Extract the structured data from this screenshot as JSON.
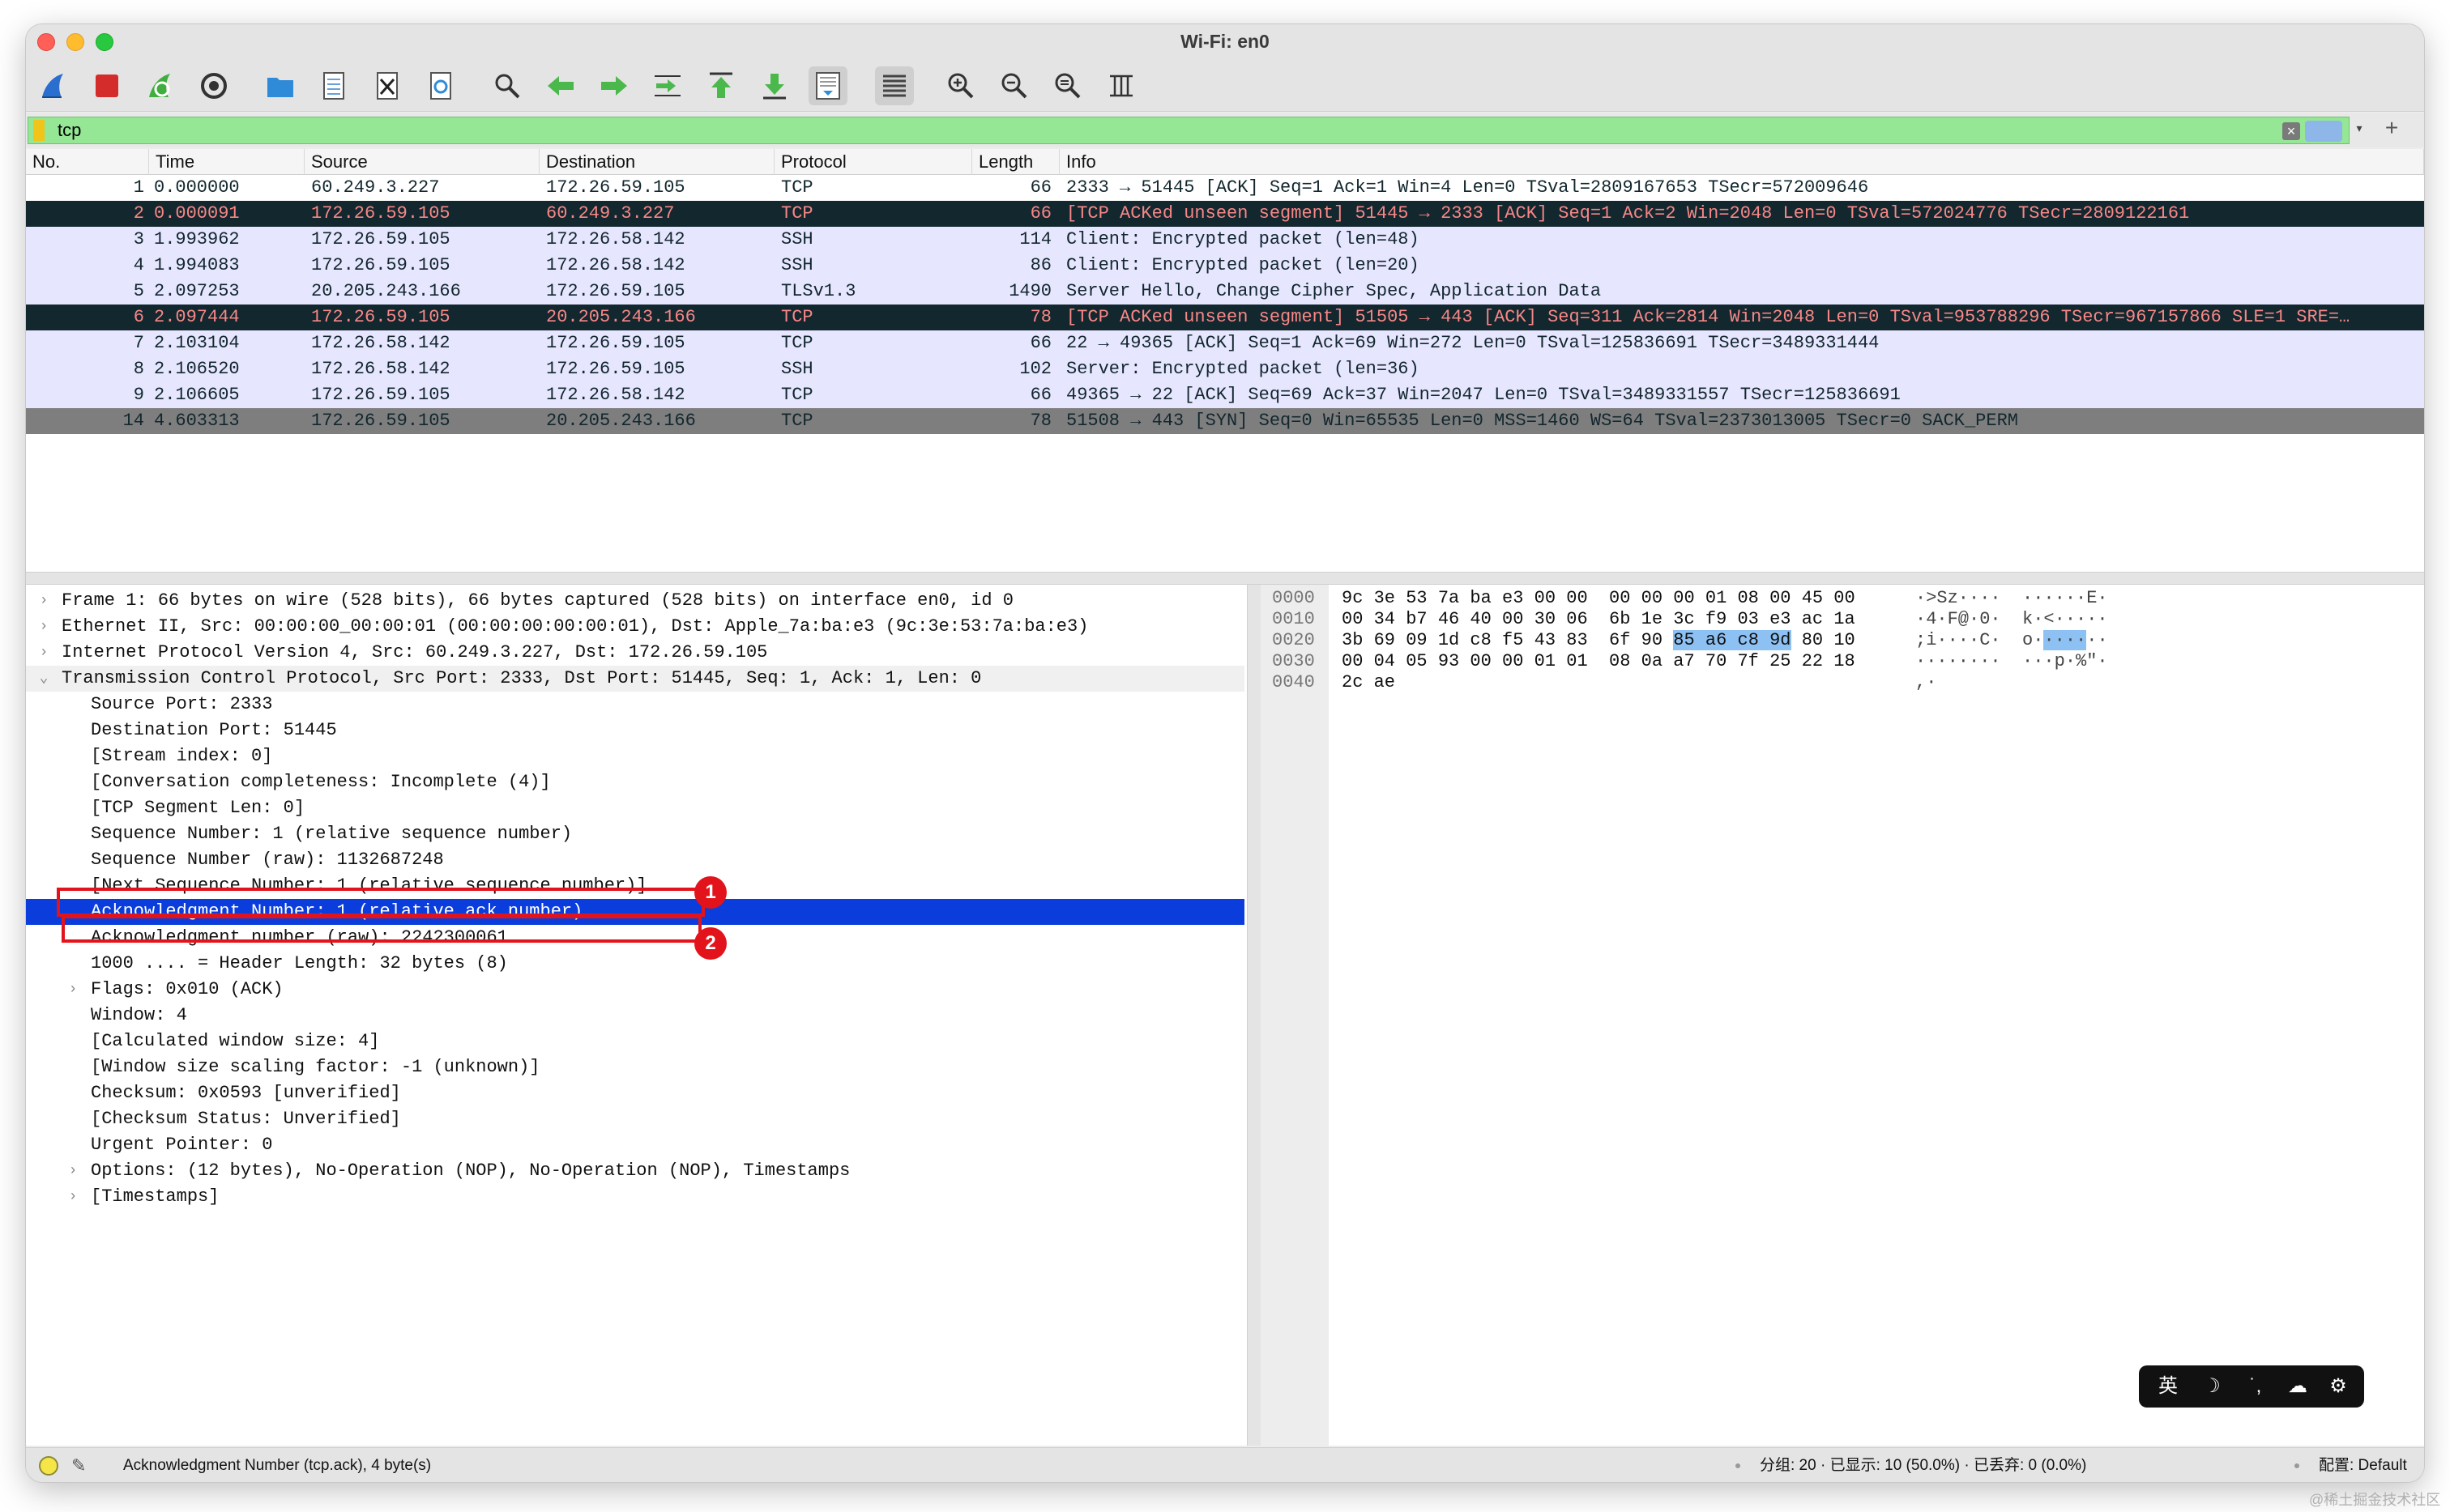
{
  "window": {
    "title": "Wi-Fi: en0"
  },
  "toolbar": {
    "icons": [
      "shark-fin-start-icon",
      "stop-capture-icon",
      "restart-capture-icon",
      "capture-options-icon",
      "open-file-icon",
      "save-file-icon",
      "close-file-icon",
      "reload-file-icon",
      "find-packet-icon",
      "go-back-icon",
      "go-forward-icon",
      "go-to-packet-icon",
      "first-packet-icon",
      "last-packet-icon",
      "autoscroll-icon",
      "colorize-icon",
      "zoom-in-icon",
      "zoom-out-icon",
      "normal-size-icon",
      "resize-columns-icon"
    ]
  },
  "filter": {
    "value": "tcp"
  },
  "packet_list": {
    "columns": [
      "No.",
      "Time",
      "Source",
      "Destination",
      "Protocol",
      "Length",
      "Info"
    ],
    "rows": [
      {
        "no": "1",
        "time": "0.000000",
        "src": "60.249.3.227",
        "dst": "172.26.59.105",
        "proto": "TCP",
        "len": "66",
        "info": "2333 → 51445 [ACK] Seq=1 Ack=1 Win=4 Len=0 TSval=2809167653 TSecr=572009646",
        "style": "r-white"
      },
      {
        "no": "2",
        "time": "0.000091",
        "src": "172.26.59.105",
        "dst": "60.249.3.227",
        "proto": "TCP",
        "len": "66",
        "info": "[TCP ACKed unseen segment] 51445 → 2333 [ACK] Seq=1 Ack=2 Win=2048 Len=0 TSval=572024776 TSecr=2809122161",
        "style": "r-err"
      },
      {
        "no": "3",
        "time": "1.993962",
        "src": "172.26.59.105",
        "dst": "172.26.58.142",
        "proto": "SSH",
        "len": "114",
        "info": "Client: Encrypted packet (len=48)",
        "style": "r-ack"
      },
      {
        "no": "4",
        "time": "1.994083",
        "src": "172.26.59.105",
        "dst": "172.26.58.142",
        "proto": "SSH",
        "len": "86",
        "info": "Client: Encrypted packet (len=20)",
        "style": "r-ack"
      },
      {
        "no": "5",
        "time": "2.097253",
        "src": "20.205.243.166",
        "dst": "172.26.59.105",
        "proto": "TLSv1.3",
        "len": "1490",
        "info": "Server Hello, Change Cipher Spec, Application Data",
        "style": "r-ack"
      },
      {
        "no": "6",
        "time": "2.097444",
        "src": "172.26.59.105",
        "dst": "20.205.243.166",
        "proto": "TCP",
        "len": "78",
        "info": "[TCP ACKed unseen segment] 51505 → 443 [ACK] Seq=311 Ack=2814 Win=2048 Len=0 TSval=953788296 TSecr=967157866 SLE=1 SRE=…",
        "style": "r-err"
      },
      {
        "no": "7",
        "time": "2.103104",
        "src": "172.26.58.142",
        "dst": "172.26.59.105",
        "proto": "TCP",
        "len": "66",
        "info": "22 → 49365 [ACK] Seq=1 Ack=69 Win=272 Len=0 TSval=125836691 TSecr=3489331444",
        "style": "r-ack"
      },
      {
        "no": "8",
        "time": "2.106520",
        "src": "172.26.58.142",
        "dst": "172.26.59.105",
        "proto": "SSH",
        "len": "102",
        "info": "Server: Encrypted packet (len=36)",
        "style": "r-ack"
      },
      {
        "no": "9",
        "time": "2.106605",
        "src": "172.26.59.105",
        "dst": "172.26.58.142",
        "proto": "TCP",
        "len": "66",
        "info": "49365 → 22 [ACK] Seq=69 Ack=37 Win=2047 Len=0 TSval=3489331557 TSecr=125836691",
        "style": "r-ack"
      },
      {
        "no": "14",
        "time": "4.603313",
        "src": "172.26.59.105",
        "dst": "20.205.243.166",
        "proto": "TCP",
        "len": "78",
        "info": "51508 → 443 [SYN] Seq=0 Win=65535 Len=0 MSS=1460 WS=64 TSval=2373013005 TSecr=0 SACK_PERM",
        "style": "r-sel"
      }
    ]
  },
  "details": {
    "rows": [
      {
        "text": "Frame 1: 66 bytes on wire (528 bits), 66 bytes captured (528 bits) on interface en0, id 0",
        "indent": 0,
        "arrow": "›",
        "cls": ""
      },
      {
        "text": "Ethernet II, Src: 00:00:00_00:00:01 (00:00:00:00:00:01), Dst: Apple_7a:ba:e3 (9c:3e:53:7a:ba:e3)",
        "indent": 0,
        "arrow": "›",
        "cls": ""
      },
      {
        "text": "Internet Protocol Version 4, Src: 60.249.3.227, Dst: 172.26.59.105",
        "indent": 0,
        "arrow": "›",
        "cls": ""
      },
      {
        "text": "Transmission Control Protocol, Src Port: 2333, Dst Port: 51445, Seq: 1, Ack: 1, Len: 0",
        "indent": 0,
        "arrow": "⌄",
        "cls": "hdr"
      },
      {
        "text": "Source Port: 2333",
        "indent": 1,
        "arrow": "",
        "cls": ""
      },
      {
        "text": "Destination Port: 51445",
        "indent": 1,
        "arrow": "",
        "cls": ""
      },
      {
        "text": "[Stream index: 0]",
        "indent": 1,
        "arrow": "",
        "cls": ""
      },
      {
        "text": "[Conversation completeness: Incomplete (4)]",
        "indent": 1,
        "arrow": "",
        "cls": ""
      },
      {
        "text": "[TCP Segment Len: 0]",
        "indent": 1,
        "arrow": "",
        "cls": ""
      },
      {
        "text": "Sequence Number: 1    (relative sequence number)",
        "indent": 1,
        "arrow": "",
        "cls": ""
      },
      {
        "text": "Sequence Number (raw): 1132687248",
        "indent": 1,
        "arrow": "",
        "cls": ""
      },
      {
        "text": "[Next Sequence Number: 1    (relative sequence number)]",
        "indent": 1,
        "arrow": "",
        "cls": ""
      },
      {
        "text": "Acknowledgment Number: 1    (relative ack number)",
        "indent": 1,
        "arrow": "",
        "cls": "sel"
      },
      {
        "text": "Acknowledgment number (raw): 2242300061",
        "indent": 1,
        "arrow": "",
        "cls": ""
      },
      {
        "text": "1000 .... = Header Length: 32 bytes (8)",
        "indent": 1,
        "arrow": "",
        "cls": ""
      },
      {
        "text": "Flags: 0x010 (ACK)",
        "indent": 1,
        "arrow": "›",
        "cls": ""
      },
      {
        "text": "Window: 4",
        "indent": 1,
        "arrow": "",
        "cls": ""
      },
      {
        "text": "[Calculated window size: 4]",
        "indent": 1,
        "arrow": "",
        "cls": ""
      },
      {
        "text": "[Window size scaling factor: -1 (unknown)]",
        "indent": 1,
        "arrow": "",
        "cls": ""
      },
      {
        "text": "Checksum: 0x0593 [unverified]",
        "indent": 1,
        "arrow": "",
        "cls": ""
      },
      {
        "text": "[Checksum Status: Unverified]",
        "indent": 1,
        "arrow": "",
        "cls": ""
      },
      {
        "text": "Urgent Pointer: 0",
        "indent": 1,
        "arrow": "",
        "cls": ""
      },
      {
        "text": "Options: (12 bytes), No-Operation (NOP), No-Operation (NOP), Timestamps",
        "indent": 1,
        "arrow": "›",
        "cls": ""
      },
      {
        "text": "[Timestamps]",
        "indent": 1,
        "arrow": "›",
        "cls": ""
      }
    ]
  },
  "annotations": {
    "badge1": "1",
    "badge2": "2"
  },
  "bytes": {
    "rows": [
      {
        "off": "0000",
        "hexA": "9c 3e 53 7a ba e3 00 00  00 00 00 01 08 00 45 00",
        "hexB": "",
        "hexC": "",
        "ascA": "·>Sz····  ······E·",
        "ascB": "",
        "ascC": ""
      },
      {
        "off": "0010",
        "hexA": "00 34 b7 46 40 00 30 06  6b 1e 3c f9 03 e3 ac 1a",
        "hexB": "",
        "hexC": "",
        "ascA": "·4·F@·0·  k·<·····",
        "ascB": "",
        "ascC": ""
      },
      {
        "off": "0020",
        "hexA": "3b 69 09 1d c8 f5 43 83  6f 90 ",
        "hexB": "85 a6 c8 9d",
        "hexC": " 80 10",
        "ascA": ";i····C·  o·",
        "ascB": "····",
        "ascC": "··"
      },
      {
        "off": "0030",
        "hexA": "00 04 05 93 00 00 01 01  08 0a a7 70 7f 25 22 18",
        "hexB": "",
        "hexC": "",
        "ascA": "········  ···p·%\"·",
        "ascB": "",
        "ascC": ""
      },
      {
        "off": "0040",
        "hexA": "2c ae",
        "hexB": "",
        "hexC": "",
        "ascA": ",·",
        "ascB": "",
        "ascC": ""
      }
    ]
  },
  "ime": {
    "lang": "英",
    "moon": "☽",
    "punct": "˙,",
    "cloud": "☁",
    "gear": "⚙"
  },
  "status": {
    "message": "Acknowledgment Number (tcp.ack), 4 byte(s)",
    "stats": "分组: 20 · 已显示: 10 (50.0%) · 已丢弃: 0 (0.0%)",
    "profile": "配置: Default"
  },
  "watermark": "@稀土掘金技术社区"
}
